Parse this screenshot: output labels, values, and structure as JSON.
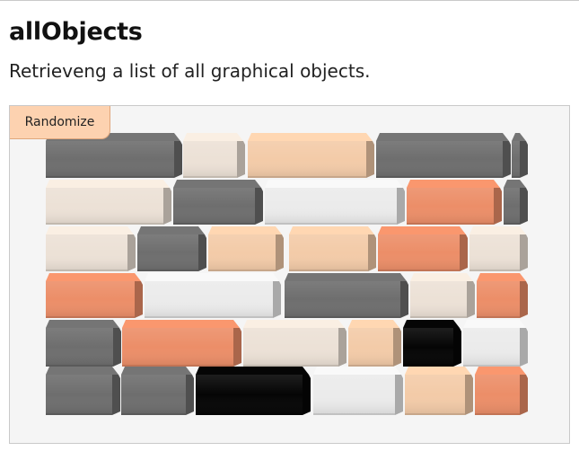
{
  "header": {
    "title": "allObjects",
    "subtitle": "Retrieveng a list of all graphical objects."
  },
  "demo": {
    "randomize_label": "Randomize"
  },
  "colors": {
    "gray": "#6e6e6e",
    "white": "#ebebeb",
    "cream": "#ece1d6",
    "peach": "#f3cba8",
    "salmon": "#ec8e68",
    "black": "#050505"
  },
  "scene": {
    "description_rows": [
      [
        "gray",
        "cream",
        "peach",
        "gray",
        "gray"
      ],
      [
        "cream",
        "gray",
        "white",
        "salmon",
        "gray"
      ],
      [
        "cream",
        "gray",
        "peach",
        "peach",
        "salmon",
        "cream"
      ],
      [
        "salmon",
        "white",
        "gray",
        "cream",
        "salmon"
      ],
      [
        "gray",
        "salmon",
        "cream",
        "peach",
        "black",
        "white"
      ],
      [
        "gray",
        "gray",
        "black",
        "white",
        "peach",
        "salmon"
      ]
    ]
  }
}
